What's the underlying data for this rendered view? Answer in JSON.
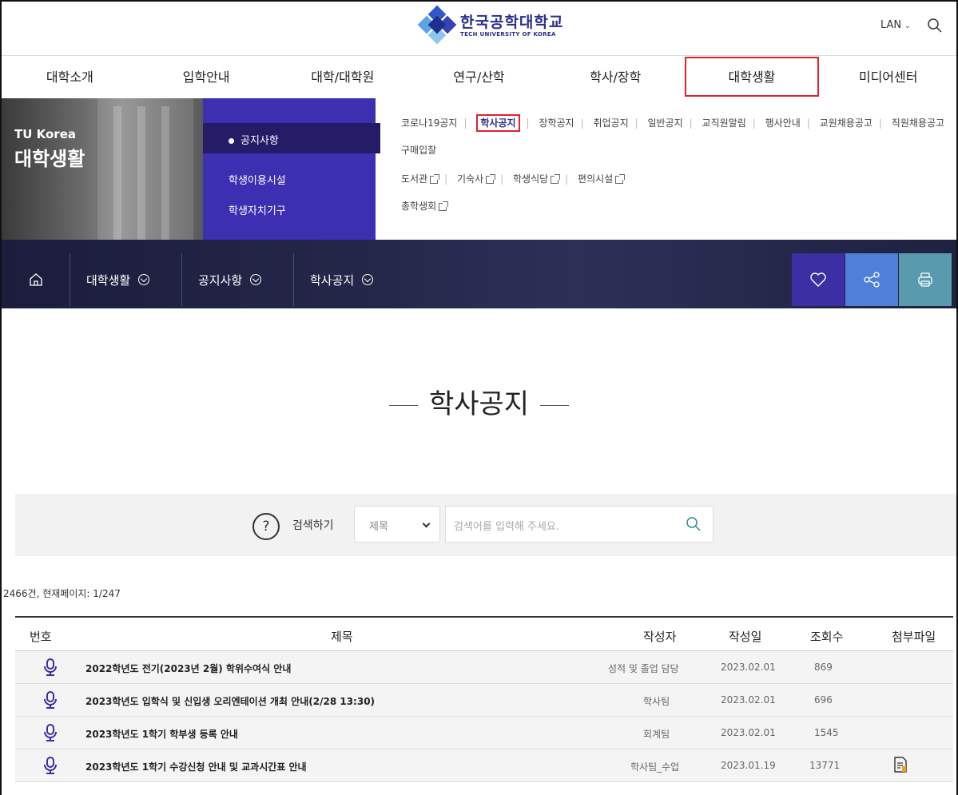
{
  "header": {
    "logo_ko": "한국공학대학교",
    "logo_en": "TECH UNIVERSITY OF KOREA",
    "lang_label": "LAN"
  },
  "nav": {
    "items": [
      "대학소개",
      "입학안내",
      "대학/대학원",
      "연구/산학",
      "학사/장학",
      "대학생활",
      "미디어센터"
    ],
    "active": "대학생활"
  },
  "panel": {
    "eyebrow": "TU Korea",
    "title": "대학생활",
    "sub_items": [
      "공지사항",
      "학생이용시설",
      "학생자치기구"
    ],
    "links_row1": [
      "코로나19공지",
      "학사공지",
      "장학공지",
      "취업공지",
      "일반공지",
      "교직원알림",
      "행사안내",
      "교원채용공고",
      "직원채용공고"
    ],
    "links_row1b": "구매입찰",
    "links_row2": [
      "도서관",
      "기숙사",
      "학생식당",
      "편의시설"
    ],
    "links_row3": "총학생회"
  },
  "breadcrumb": {
    "items": [
      "대학생활",
      "공지사항",
      "학사공지"
    ]
  },
  "page": {
    "title": "학사공지"
  },
  "search": {
    "label": "검색하기",
    "select_value": "제목",
    "placeholder": "검색어를 입력해 주세요."
  },
  "list": {
    "count_text": "2466건, 현재페이지: 1/247",
    "headers": [
      "번호",
      "제목",
      "작성자",
      "작성일",
      "조회수",
      "첨부파일"
    ],
    "rows": [
      {
        "title": "2022학년도 전기(2023년 2월) 학위수여식 안내",
        "author": "성적 및 졸업 담당",
        "date": "2023.02.01",
        "views": "869",
        "attach": false
      },
      {
        "title": "2023학년도 입학식 및 신입생 오리엔테이션 개최 안내(2/28 13:30)",
        "author": "학사팀",
        "date": "2023.02.01",
        "views": "696",
        "attach": false
      },
      {
        "title": "2023학년도 1학기 학부생 등록 안내",
        "author": "회계팀",
        "date": "2023.02.01",
        "views": "1545",
        "attach": false
      },
      {
        "title": "2023학년도 1학기 수강신청 안내 및 교과시간표 안내",
        "author": "학사팀_수업",
        "date": "2023.01.19",
        "views": "13771",
        "attach": true
      }
    ]
  },
  "colors": {
    "brand": "#2b2e8a",
    "panel_purple": "#3c2fb1",
    "highlight_red": "#e0212b",
    "like_btn": "#3b2fa3",
    "share_btn": "#4f7fd6",
    "print_btn": "#5a9aaf"
  }
}
